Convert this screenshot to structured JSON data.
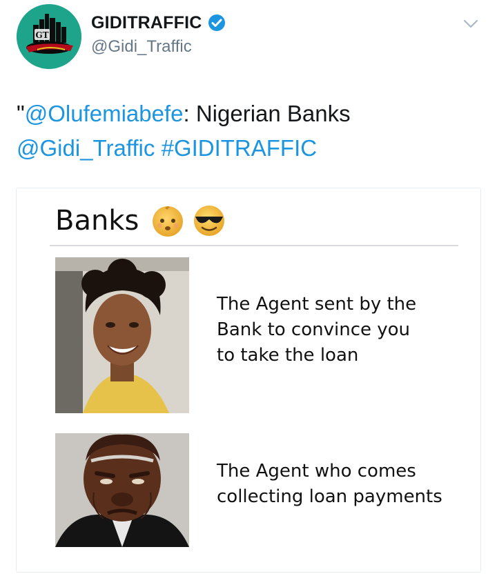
{
  "tweet": {
    "author": {
      "display_name": "GIDITRAFFIC",
      "handle": "@Gidi_Traffic",
      "verified": true,
      "avatar_text": "GT"
    },
    "menu_icon": "chevron-down-icon",
    "text": {
      "quote_open": "\"",
      "mention_1": "@Olufemiabefe",
      "sep": ": Nigerian Banks",
      "mention_2": "@Gidi_Traffic",
      "space": " ",
      "hashtag": "#GIDITRAFFIC"
    },
    "link_color": "#1b95e0"
  },
  "meme": {
    "title": "Banks",
    "emojis": [
      "baby-face-emoji",
      "sunglasses-face-emoji"
    ],
    "panels": [
      {
        "photo": "smiling-woman-photo",
        "caption_lines": [
          "The Agent sent by the",
          "Bank to convince you",
          "to take the loan"
        ]
      },
      {
        "photo": "angry-old-man-photo",
        "caption_lines": [
          "The Agent who comes",
          "collecting loan payments"
        ]
      }
    ]
  }
}
